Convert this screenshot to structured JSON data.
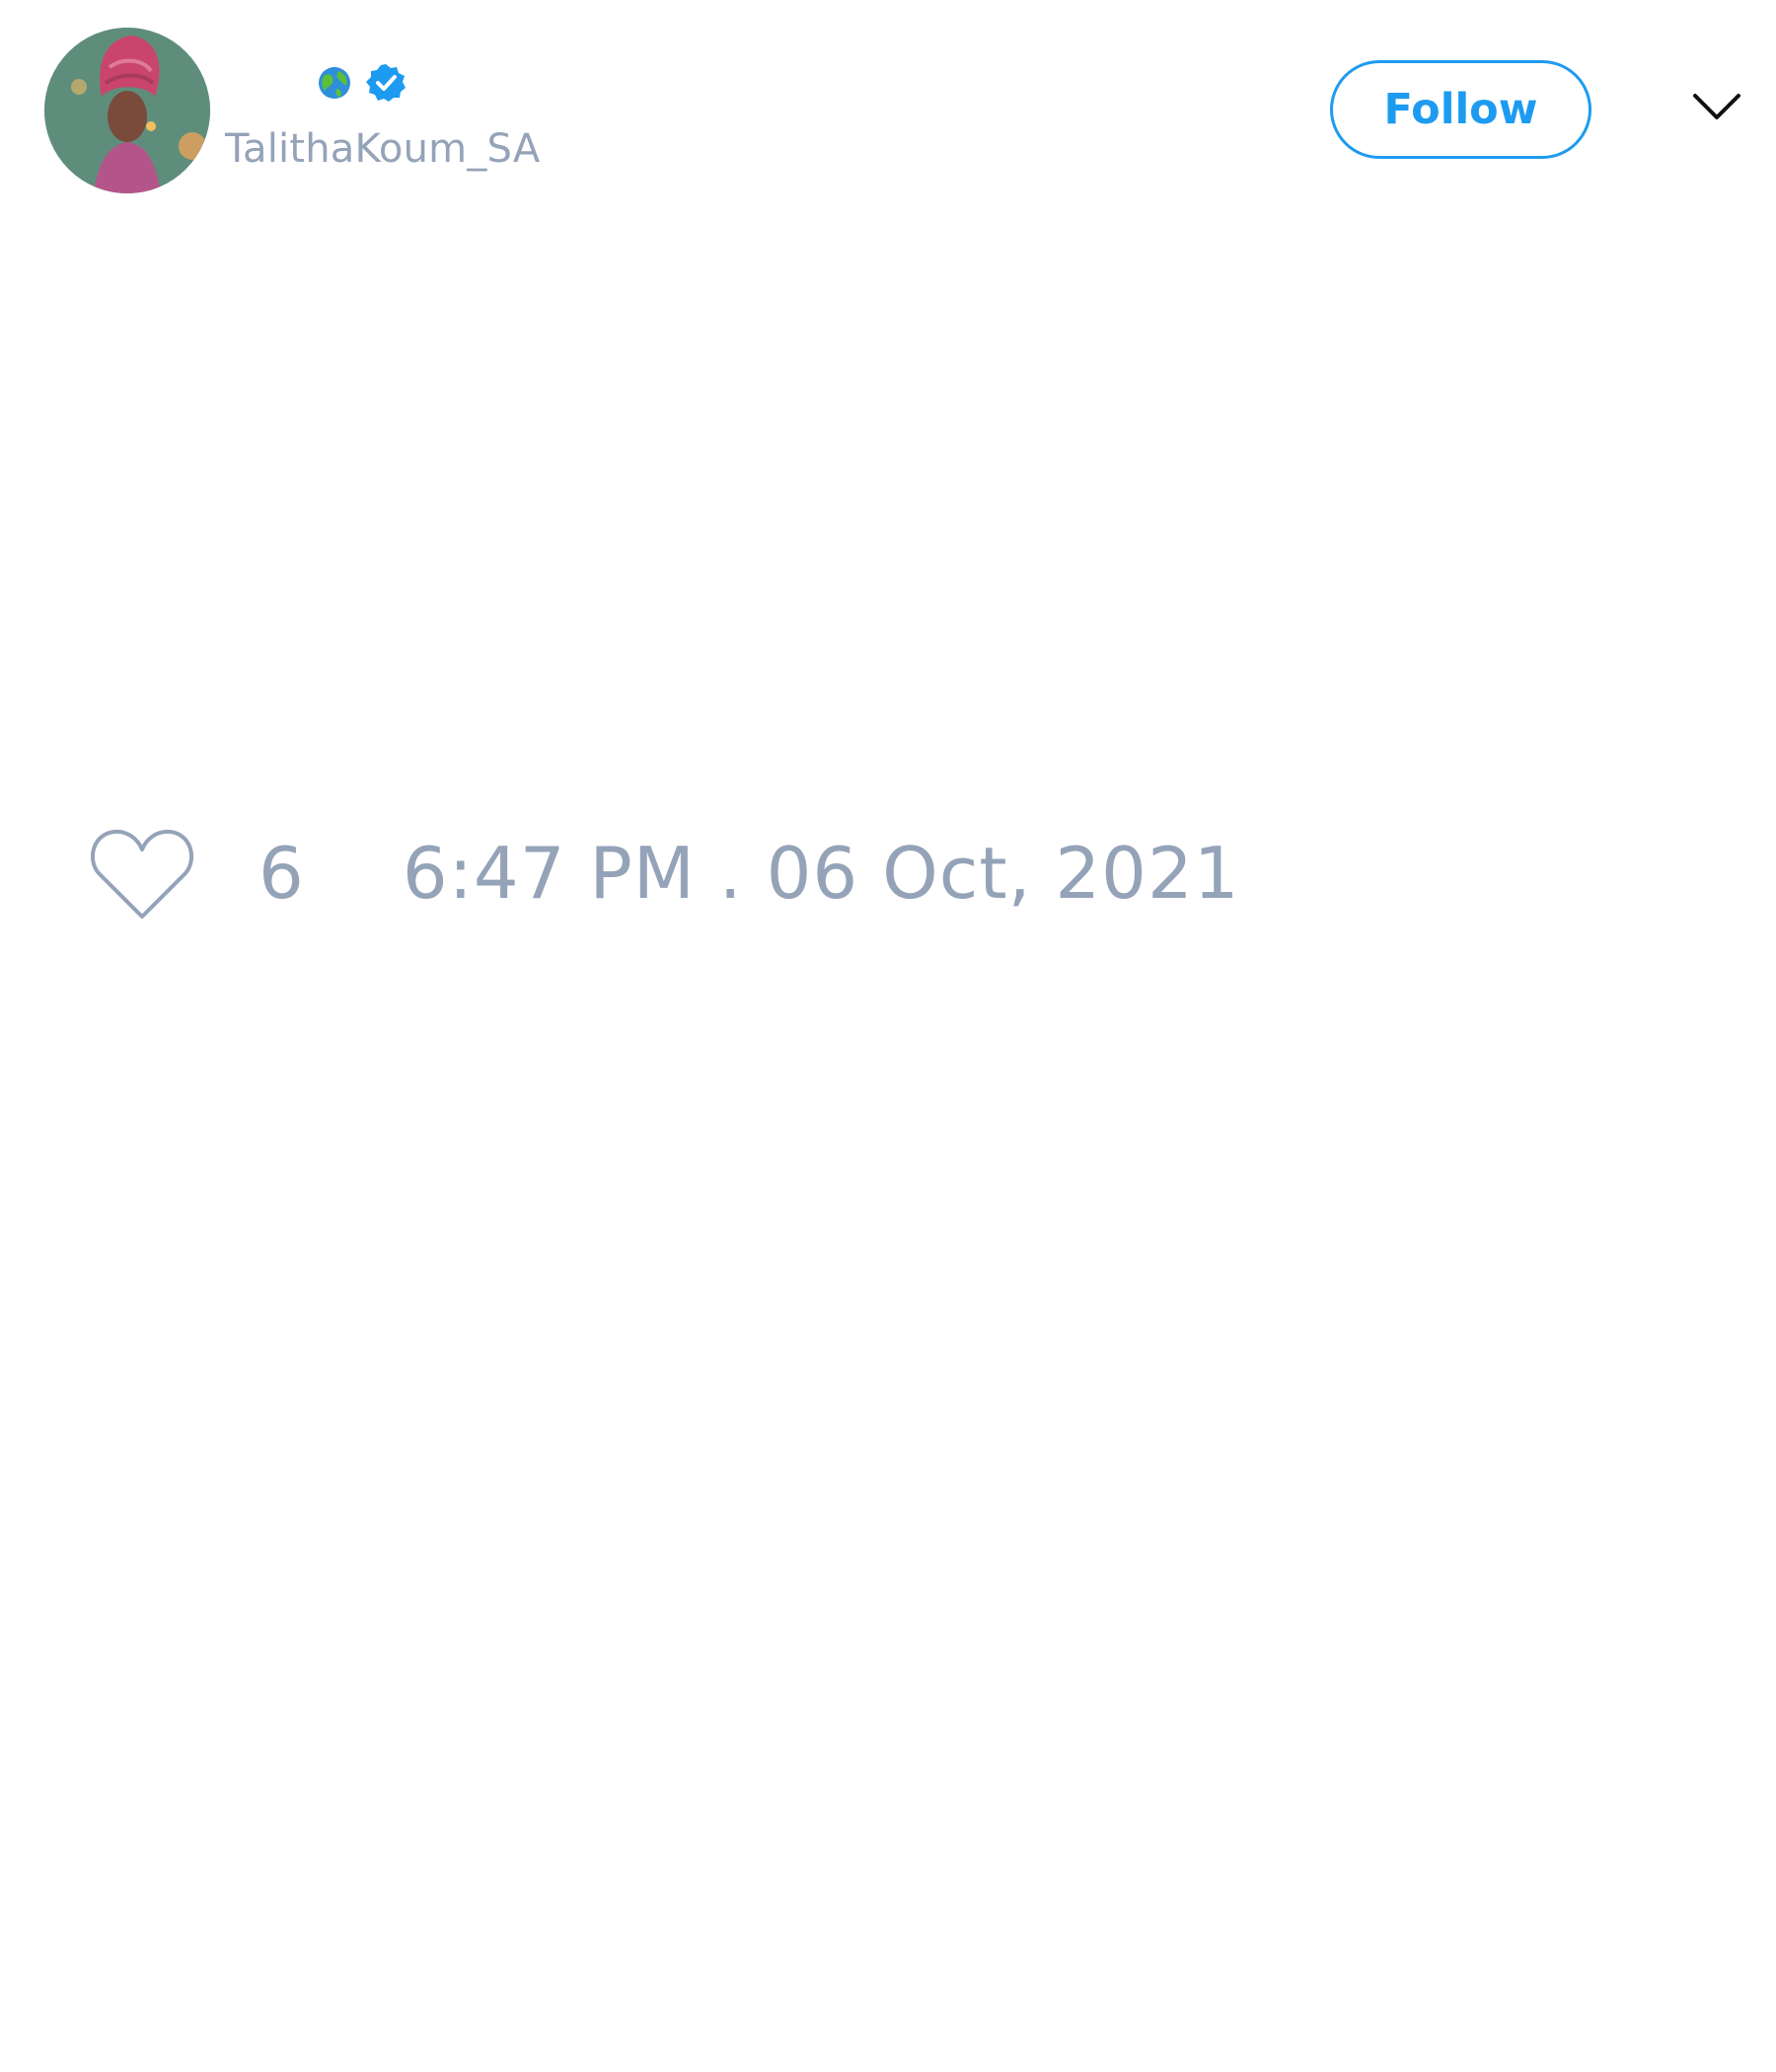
{
  "tweet": {
    "author": {
      "handle": "TalithaKoum_SA",
      "name_icons": [
        "globe-icon",
        "verified-icon"
      ],
      "avatar": "avatar"
    },
    "follow_label": "Follow",
    "menu_icon": "chevron-down-icon",
    "likes": {
      "icon": "heart-icon",
      "count": "6"
    },
    "timestamp": "6:47 PM . 06 Oct, 2021"
  },
  "colors": {
    "accent": "#1d9bf0",
    "muted_text": "#94a3b8",
    "background": "#ffffff"
  }
}
